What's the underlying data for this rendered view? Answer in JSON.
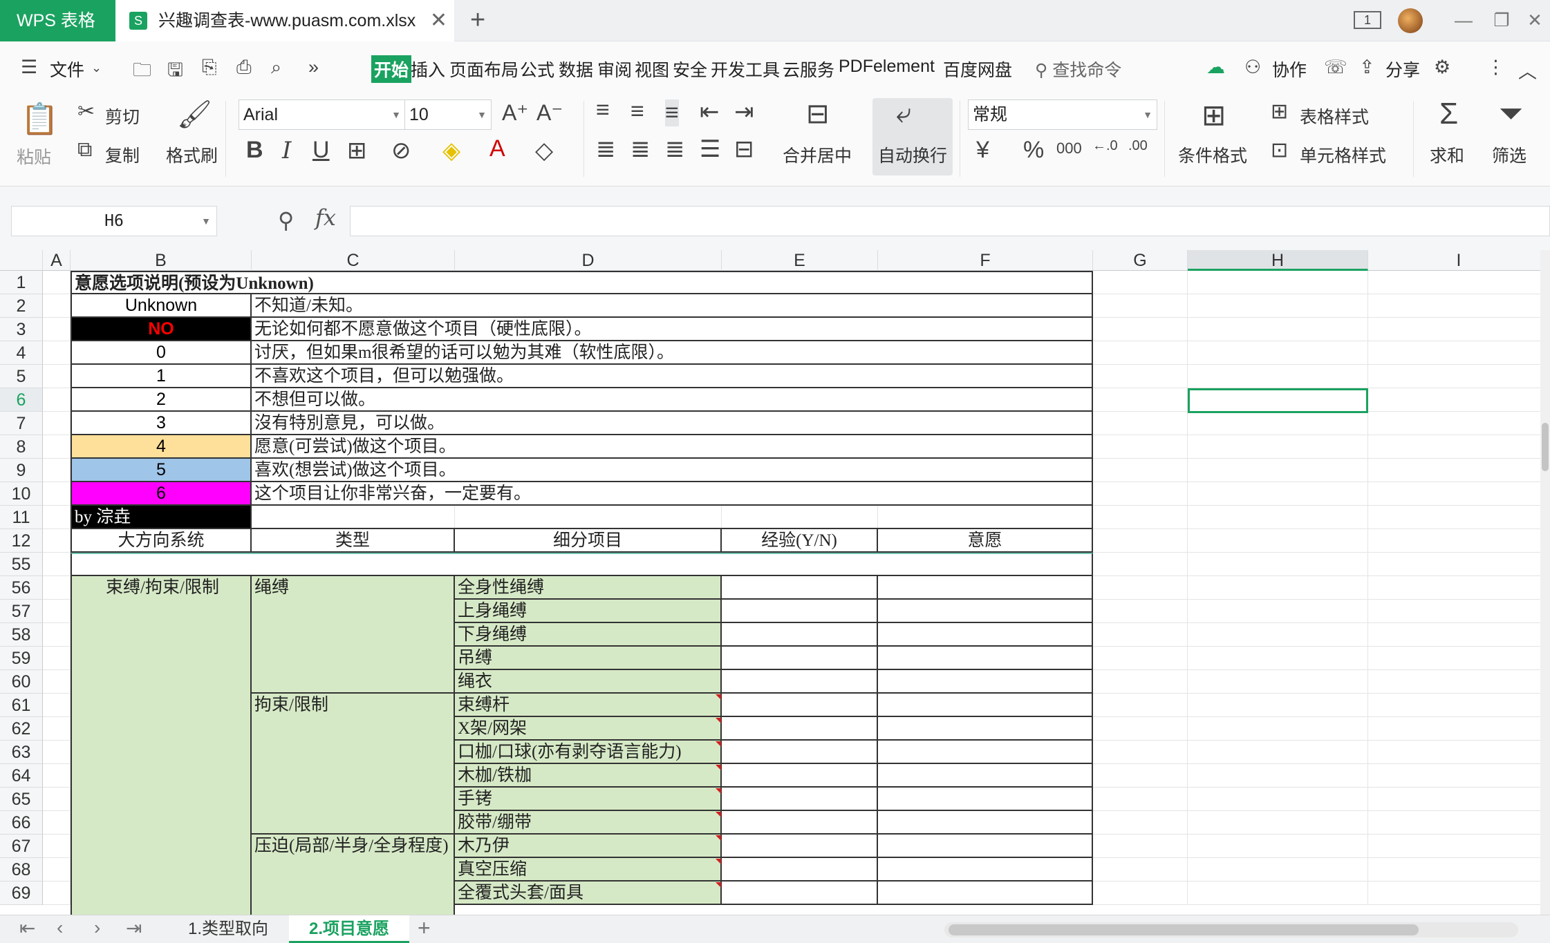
{
  "titlebar": {
    "app_name": "WPS 表格",
    "file_icon": "S",
    "file_name": "兴趣调查表-www.puasm.com.xlsx",
    "close_tab": "✕",
    "new_tab": "+",
    "window_count": "1",
    "minimize": "—",
    "restore": "❐",
    "close": "✕"
  },
  "menu": {
    "hamburger": "☰",
    "file": "文件",
    "start": "开始",
    "items": [
      "插入",
      "页面布局",
      "公式",
      "数据",
      "审阅",
      "视图",
      "安全",
      "开发工具",
      "云服务",
      "PDFelement",
      "百度网盘"
    ],
    "search": "查找命令",
    "collab": "协作",
    "share": "分享",
    "more": "»"
  },
  "ribbon": {
    "paste": "粘贴",
    "cut": "剪切",
    "copy": "复制",
    "format_painter": "格式刷",
    "font_name": "Arial",
    "font_size": "10",
    "merge_center": "合并居中",
    "auto_wrap": "自动换行",
    "number_format": "常规",
    "currency": "¥",
    "percent": "%",
    "thousands": "000",
    "cond_format": "条件格式",
    "table_style": "表格样式",
    "cell_style": "单元格样式",
    "sum": "求和",
    "filter": "筛选"
  },
  "formula": {
    "cell_ref": "H6",
    "fx": "fx",
    "value": ""
  },
  "columns": [
    "A",
    "B",
    "C",
    "D",
    "E",
    "F",
    "G",
    "H",
    "I"
  ],
  "rows": [
    "1",
    "2",
    "3",
    "4",
    "5",
    "6",
    "7",
    "8",
    "9",
    "10",
    "11",
    "12",
    "55",
    "56",
    "57",
    "58",
    "59",
    "60",
    "61",
    "62",
    "63",
    "64",
    "65",
    "66",
    "67",
    "68",
    "69"
  ],
  "legend": {
    "title": "意愿选项说明(预设为Unknown)",
    "items": [
      {
        "code": "Unknown",
        "desc": "不知道/未知。",
        "bg": "#ffffff",
        "fg": "#000000"
      },
      {
        "code": "NO",
        "desc": "无论如何都不愿意做这个项目（硬性底限）。",
        "bg": "#000000",
        "fg": "#ff0000"
      },
      {
        "code": "0",
        "desc": "讨厌，但如果m很希望的话可以勉为其难（软性底限）。",
        "bg": "#ffffff",
        "fg": "#000000"
      },
      {
        "code": "1",
        "desc": "不喜欢这个项目，但可以勉强做。",
        "bg": "#ffffff",
        "fg": "#000000"
      },
      {
        "code": "2",
        "desc": "不想但可以做。",
        "bg": "#ffffff",
        "fg": "#000000"
      },
      {
        "code": "3",
        "desc": "沒有特別意見，可以做。",
        "bg": "#ffffff",
        "fg": "#000000"
      },
      {
        "code": "4",
        "desc": "愿意(可尝试)做这个项目。",
        "bg": "#ffe09a",
        "fg": "#000000"
      },
      {
        "code": "5",
        "desc": "喜欢(想尝试)做这个项目。",
        "bg": "#9fc5e8",
        "fg": "#000000"
      },
      {
        "code": "6",
        "desc": "这个项目让你非常兴奋，一定要有。",
        "bg": "#ff00ff",
        "fg": "#000000"
      }
    ],
    "author": "by 淙垚"
  },
  "table": {
    "headers": [
      "大方向系统",
      "类型",
      "细分项目",
      "经验(Y/N)",
      "意愿"
    ],
    "category": "束缚/拘束/限制",
    "groups": [
      {
        "type": "绳缚",
        "items": [
          "全身性绳缚",
          "上身绳缚",
          "下身绳缚",
          "吊缚",
          "绳衣"
        ]
      },
      {
        "type": "拘束/限制",
        "items": [
          "束缚杆",
          "X架/网架",
          "口枷/口球(亦有剥夺语言能力)",
          "木枷/铁枷",
          "手铐",
          "胶带/绷带"
        ]
      },
      {
        "type": "压迫(局部/半身/全身程度)",
        "items": [
          "木乃伊",
          "真空压缩",
          "全覆式头套/面具"
        ]
      }
    ]
  },
  "sheets": {
    "tab1": "1.类型取向",
    "tab2": "2.项目意愿",
    "add": "+"
  }
}
